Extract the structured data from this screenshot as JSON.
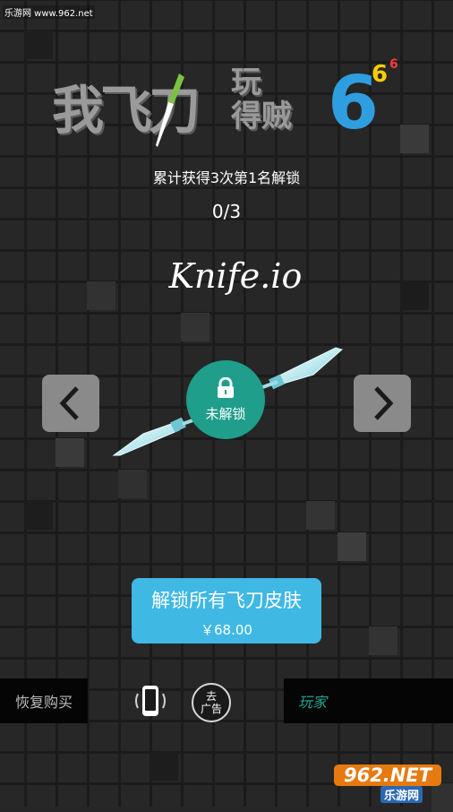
{
  "watermark_top": "乐游网 www.962.net",
  "logo": {
    "chars_big": "我飞刀",
    "chars_small_top": "玩",
    "chars_small_bottom": "得贼",
    "six_big": "6",
    "six_medium": "6",
    "six_small": "6"
  },
  "unlock_condition": "累计获得3次第1名解锁",
  "progress": "0/3",
  "skin_name": "Knife.io",
  "lock_status": "未解锁",
  "buy_all": {
    "title": "解锁所有飞刀皮肤",
    "price": "￥68.00"
  },
  "restore_purchase": "恢复购买",
  "ad_button": {
    "line1": "去",
    "line2": "广告"
  },
  "player_button": "玩家",
  "watermark_bottom": {
    "logo": "962.NET",
    "sub": "乐游网"
  },
  "colors": {
    "accent_teal": "#1f9e8c",
    "buy_blue": "#3fb8e4",
    "logo_blue": "#2f9ee0",
    "arrow_gray": "#8a8a8a"
  },
  "icons": [
    "chevron-left-icon",
    "chevron-right-icon",
    "lock-icon",
    "vibrate-phone-icon",
    "knife-icon"
  ]
}
